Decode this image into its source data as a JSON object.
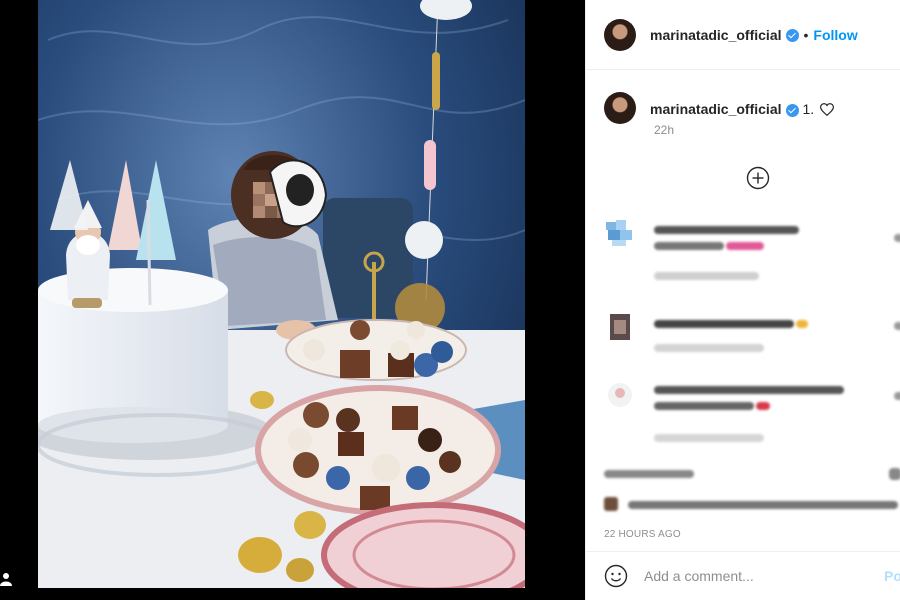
{
  "post": {
    "username": "marinatadic_official",
    "follow_label": "Follow",
    "separator": "•"
  },
  "caption": {
    "username": "marinatadic_official",
    "text": "1.",
    "time": "22h"
  },
  "footer": {
    "timestamp": "22 HOURS AGO",
    "comment_placeholder": "Add a comment...",
    "post_label": "Po"
  },
  "colors": {
    "link_blue": "#0095f6",
    "verified_blue": "#3897f0",
    "muted_text": "#8e8e8e",
    "backdrop_blue": "#1e3a63"
  }
}
